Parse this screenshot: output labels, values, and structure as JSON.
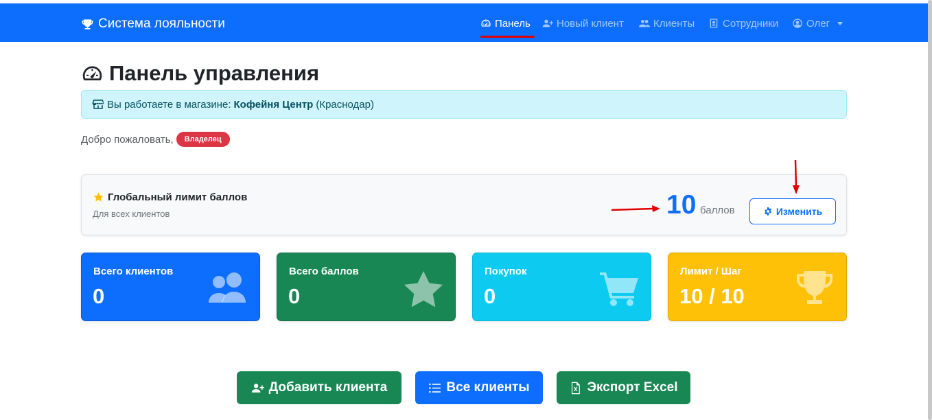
{
  "navbar": {
    "brand": "Система лояльности",
    "items": [
      {
        "label": "Панель",
        "icon": "speedometer-icon",
        "active": true
      },
      {
        "label": "Новый клиент",
        "icon": "user-plus-icon",
        "active": false
      },
      {
        "label": "Клиенты",
        "icon": "users-icon",
        "active": false
      },
      {
        "label": "Сотрудники",
        "icon": "badge-icon",
        "active": false
      },
      {
        "label": "Олег",
        "icon": "user-circle-icon",
        "active": false,
        "dropdown": true
      }
    ]
  },
  "page": {
    "title": "Панель управления"
  },
  "alert": {
    "prefix": "Вы работаете в магазине:",
    "store": "Кофейня Центр",
    "city": "(Краснодар)"
  },
  "welcome": {
    "text": "Добро пожаловать,",
    "role": "Владелец"
  },
  "limit": {
    "title": "Глобальный лимит баллов",
    "subtitle": "Для всех клиентов",
    "value": "10",
    "unit": "баллов",
    "button": "Изменить"
  },
  "stats": [
    {
      "label": "Всего клиентов",
      "value": "0",
      "icon": "users-icon",
      "color": "#0d6efd"
    },
    {
      "label": "Всего баллов",
      "value": "0",
      "icon": "star-icon",
      "color": "#198754"
    },
    {
      "label": "Покупок",
      "value": "0",
      "icon": "cart-icon",
      "color": "#0dcaf0"
    },
    {
      "label": "Лимит / Шаг",
      "value": "10 / 10",
      "icon": "trophy-icon",
      "color": "#ffc107"
    }
  ],
  "actions": [
    {
      "label": "Добавить клиента",
      "icon": "user-plus-icon"
    },
    {
      "label": "Все клиенты",
      "icon": "list-icon"
    },
    {
      "label": "Экспорт Excel",
      "icon": "file-excel-icon"
    }
  ],
  "colors": {
    "primary": "#0d6efd",
    "success": "#198754",
    "info": "#0dcaf0",
    "warning": "#ffc107",
    "danger": "#dc3545",
    "annotation": "#e00000"
  }
}
